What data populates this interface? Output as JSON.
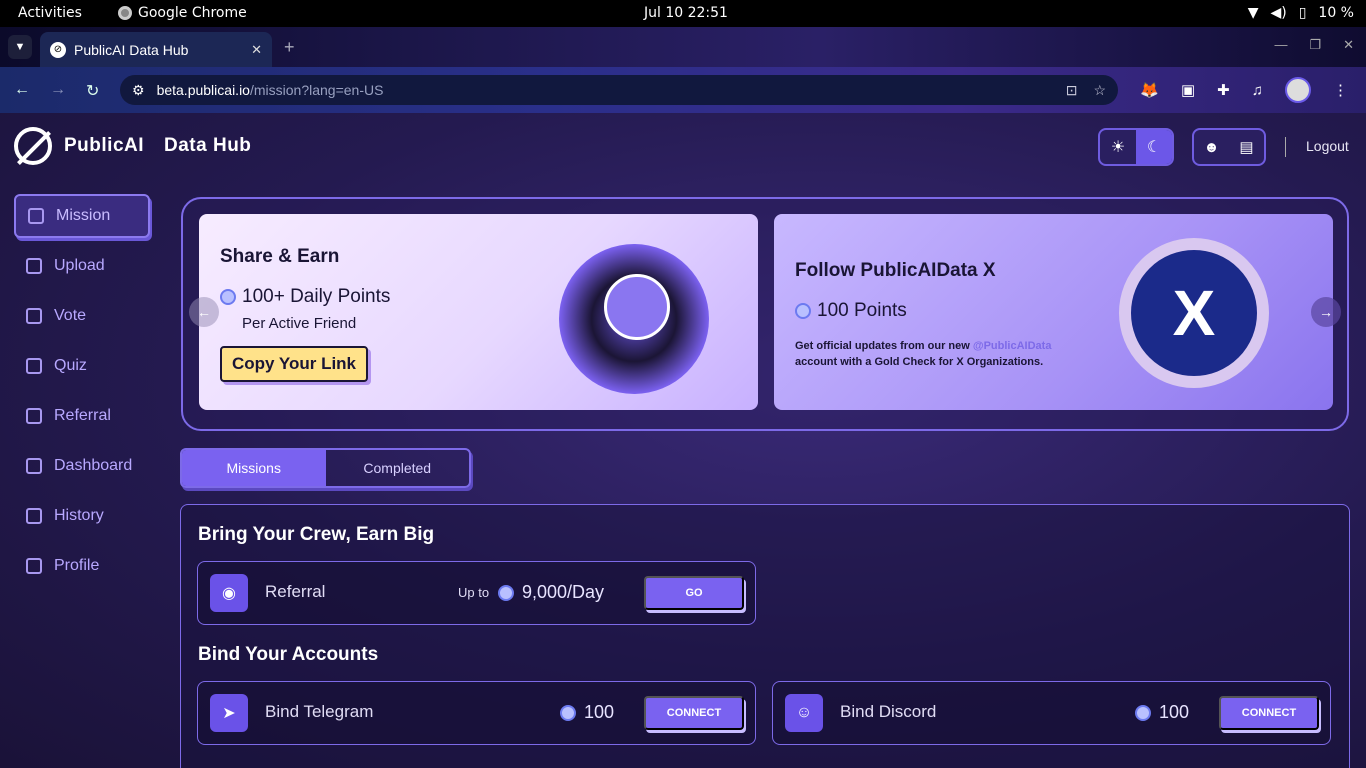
{
  "os": {
    "activities": "Activities",
    "app": "Google Chrome",
    "clock": "Jul 10  22:51",
    "battery": "10 %"
  },
  "browser": {
    "tab_title": "PublicAI Data Hub",
    "url_host": "beta.publicai.io",
    "url_path": "/mission?lang=en-US"
  },
  "header": {
    "brand": "PublicAI",
    "subtitle": "Data Hub",
    "logout": "Logout"
  },
  "sidebar": {
    "items": [
      {
        "label": "Mission"
      },
      {
        "label": "Upload"
      },
      {
        "label": "Vote"
      },
      {
        "label": "Quiz"
      },
      {
        "label": "Referral"
      },
      {
        "label": "Dashboard"
      },
      {
        "label": "History"
      },
      {
        "label": "Profile"
      }
    ]
  },
  "banners": {
    "share": {
      "title": "Share & Earn",
      "points": "100+ Daily Points",
      "sub": "Per Active Friend",
      "button": "Copy Your Link"
    },
    "follow": {
      "title": "Follow PublicAIData X",
      "points": "100 Points",
      "desc_a": "Get official updates from our new ",
      "handle": "@PublicAIData",
      "desc_b": " account with a Gold Check for X Organizations."
    }
  },
  "tabs": {
    "missions": "Missions",
    "completed": "Completed"
  },
  "sections": {
    "crew": {
      "title": "Bring Your Crew, Earn Big",
      "referral": {
        "label": "Referral",
        "upto": "Up to",
        "value": "9,000/Day",
        "button": "GO"
      }
    },
    "bind": {
      "title": "Bind Your Accounts",
      "telegram": {
        "label": "Bind Telegram",
        "value": "100",
        "button": "CONNECT"
      },
      "discord": {
        "label": "Bind Discord",
        "value": "100",
        "button": "CONNECT"
      }
    }
  }
}
